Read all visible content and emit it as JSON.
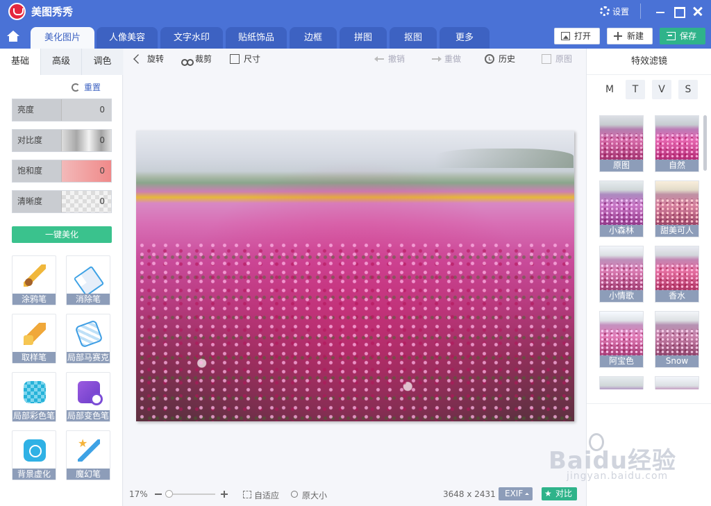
{
  "app": {
    "title": "美图秀秀",
    "settings_label": "设置"
  },
  "tabs": [
    {
      "label": "美化图片",
      "active": true
    },
    {
      "label": "人像美容",
      "active": false
    },
    {
      "label": "文字水印",
      "active": false
    },
    {
      "label": "贴纸饰品",
      "active": false
    },
    {
      "label": "边框",
      "active": false
    },
    {
      "label": "拼图",
      "active": false
    },
    {
      "label": "抠图",
      "active": false
    },
    {
      "label": "更多",
      "active": false
    }
  ],
  "header_buttons": {
    "open": "打开",
    "new": "新建",
    "save": "保存"
  },
  "left_panel": {
    "subtabs": [
      {
        "label": "基础",
        "active": true
      },
      {
        "label": "高级",
        "active": false
      },
      {
        "label": "调色",
        "active": false
      }
    ],
    "reset_label": "重置",
    "sliders": [
      {
        "label": "亮度",
        "value": "0"
      },
      {
        "label": "对比度",
        "value": "0"
      },
      {
        "label": "饱和度",
        "value": "0"
      },
      {
        "label": "清晰度",
        "value": "0"
      }
    ],
    "one_key_label": "一键美化",
    "tools": [
      {
        "label": "涂鸦笔",
        "icon": "brush-icon"
      },
      {
        "label": "消除笔",
        "icon": "eraser-icon"
      },
      {
        "label": "取样笔",
        "icon": "stamp-icon"
      },
      {
        "label": "局部马赛克",
        "icon": "mosaic-icon"
      },
      {
        "label": "局部彩色笔",
        "icon": "color-pen-icon"
      },
      {
        "label": "局部变色笔",
        "icon": "recolor-pen-icon"
      },
      {
        "label": "背景虚化",
        "icon": "blur-background-icon"
      },
      {
        "label": "魔幻笔",
        "icon": "magic-pen-icon"
      }
    ]
  },
  "canvas_toolbar": {
    "rotate": "旋转",
    "crop": "裁剪",
    "size": "尺寸",
    "undo": "撤销",
    "redo": "重做",
    "history": "历史",
    "original": "原图"
  },
  "status_bar": {
    "zoom": "17%",
    "zoom_level": 0.17,
    "fit_label": "自适应",
    "actual_size_label": "原大小",
    "dimensions": "3648 x 2431",
    "exif_label": "EXIF",
    "compare_label": "对比"
  },
  "right_panel": {
    "title": "特效滤镜",
    "categories": [
      "M",
      "T",
      "V",
      "S"
    ],
    "filters": [
      {
        "label": "原图",
        "cls": "t-orig"
      },
      {
        "label": "自然",
        "cls": "t-natural"
      },
      {
        "label": "小森林",
        "cls": "t-forest"
      },
      {
        "label": "甜美可人",
        "cls": "t-sweet"
      },
      {
        "label": "小情歌",
        "cls": "t-love"
      },
      {
        "label": "香水",
        "cls": "t-perfume"
      },
      {
        "label": "阿宝色",
        "cls": "t-abao"
      },
      {
        "label": "Snow",
        "cls": "t-snow"
      }
    ]
  },
  "watermark": {
    "text": "Baidu经验",
    "sub": "jingyan.baidu.com"
  },
  "colors": {
    "accent": "#4a72d6",
    "green": "#2fb38a",
    "label_bg": "#8d9db9"
  }
}
